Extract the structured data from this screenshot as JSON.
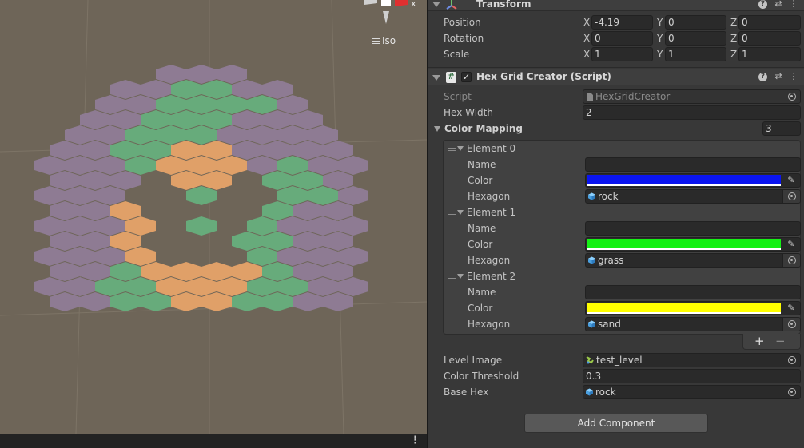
{
  "scene": {
    "view_mode_label": "Iso",
    "gizmo_axis_label": "x",
    "hex_colors": {
      "purple": "#8e7b93",
      "green": "#67ab7b",
      "orange": "#e0a068",
      "background": "#6e6558"
    }
  },
  "transform": {
    "title": "Transform",
    "position_label": "Position",
    "rotation_label": "Rotation",
    "scale_label": "Scale",
    "axis_x": "X",
    "axis_y": "Y",
    "axis_z": "Z",
    "position": {
      "x": "-4.19",
      "y": "0",
      "z": "0"
    },
    "rotation": {
      "x": "0",
      "y": "0",
      "z": "0"
    },
    "scale": {
      "x": "1",
      "y": "1",
      "z": "1"
    }
  },
  "hex_grid_creator": {
    "title": "Hex Grid Creator (Script)",
    "enabled": true,
    "script_label": "Script",
    "script_value": "HexGridCreator",
    "hex_width_label": "Hex Width",
    "hex_width_value": "2",
    "color_mapping_label": "Color Mapping",
    "color_mapping_count": "3",
    "name_label": "Name",
    "color_label": "Color",
    "hexagon_label": "Hexagon",
    "elements": [
      {
        "header": "Element 0",
        "name": "",
        "color": "#0a14f0",
        "hexagon": "rock"
      },
      {
        "header": "Element 1",
        "name": "",
        "color": "#14f014",
        "hexagon": "grass"
      },
      {
        "header": "Element 2",
        "name": "",
        "color": "#ffff00",
        "hexagon": "sand"
      }
    ],
    "add_label": "+",
    "remove_label": "−",
    "level_image_label": "Level Image",
    "level_image_value": "test_level",
    "color_threshold_label": "Color Threshold",
    "color_threshold_value": "0.3",
    "base_hex_label": "Base Hex",
    "base_hex_value": "rock"
  },
  "add_component_label": "Add Component",
  "header_icons": {
    "help": "?",
    "presets": "⇄",
    "menu": "⋮"
  }
}
